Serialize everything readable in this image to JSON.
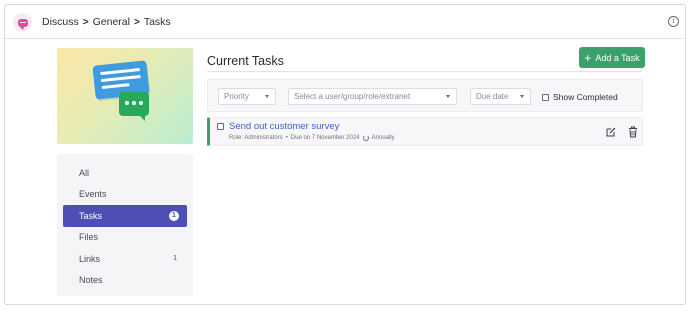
{
  "header": {
    "breadcrumb": [
      "Discuss",
      "General",
      "Tasks"
    ],
    "separator": ">"
  },
  "sidebar": {
    "items": [
      {
        "label": "All",
        "count": ""
      },
      {
        "label": "Events",
        "count": ""
      },
      {
        "label": "Tasks",
        "count": "1",
        "active": true
      },
      {
        "label": "Files",
        "count": ""
      },
      {
        "label": "Links",
        "count": "1"
      },
      {
        "label": "Notes",
        "count": ""
      }
    ]
  },
  "main": {
    "title": "Current Tasks",
    "add_button": {
      "icon": "+",
      "label": "Add a Task"
    },
    "filters": {
      "priority": "Priority",
      "assignee_placeholder": "Select a user/group/role/extranet",
      "due_date": "Due date",
      "show_completed": "Show Completed"
    },
    "tasks": [
      {
        "title": "Send out customer survey",
        "role": "Role: Administrators",
        "bullet": "•",
        "due": "Due on 7 November 2024",
        "recurrence": "Annually"
      }
    ]
  },
  "colors": {
    "accent": "#4d4fb5",
    "success": "#3aa16b",
    "link": "#3e5fc2"
  },
  "icons": [
    "app-logo-icon",
    "info-icon",
    "plus-icon",
    "caret-down-icon",
    "repeat-icon",
    "edit-icon",
    "trash-icon"
  ]
}
